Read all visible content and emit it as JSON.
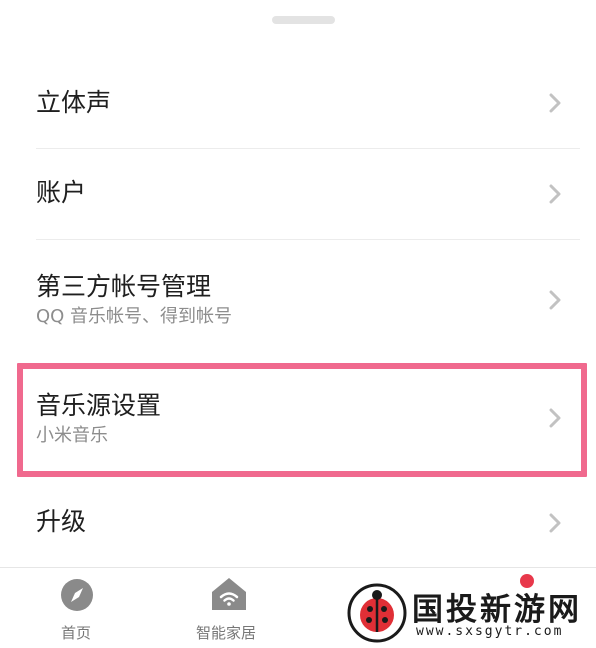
{
  "settings": {
    "items": [
      {
        "title": "立体声"
      },
      {
        "title": "账户"
      },
      {
        "title": "第三方帐号管理",
        "subtitle": "QQ 音乐帐号、得到帐号"
      },
      {
        "title": "音乐源设置",
        "subtitle": "小米音乐"
      },
      {
        "title": "升级"
      }
    ],
    "highlight_color": "#f0698e"
  },
  "tabbar": {
    "tabs": [
      {
        "label": "首页",
        "icon": "compass-icon"
      },
      {
        "label": "智能家居",
        "icon": "smart-home-icon"
      }
    ],
    "badge_color": "#e8384b"
  },
  "watermark": {
    "brand": "国投新游网",
    "url": "www.sxsgytr.com"
  }
}
